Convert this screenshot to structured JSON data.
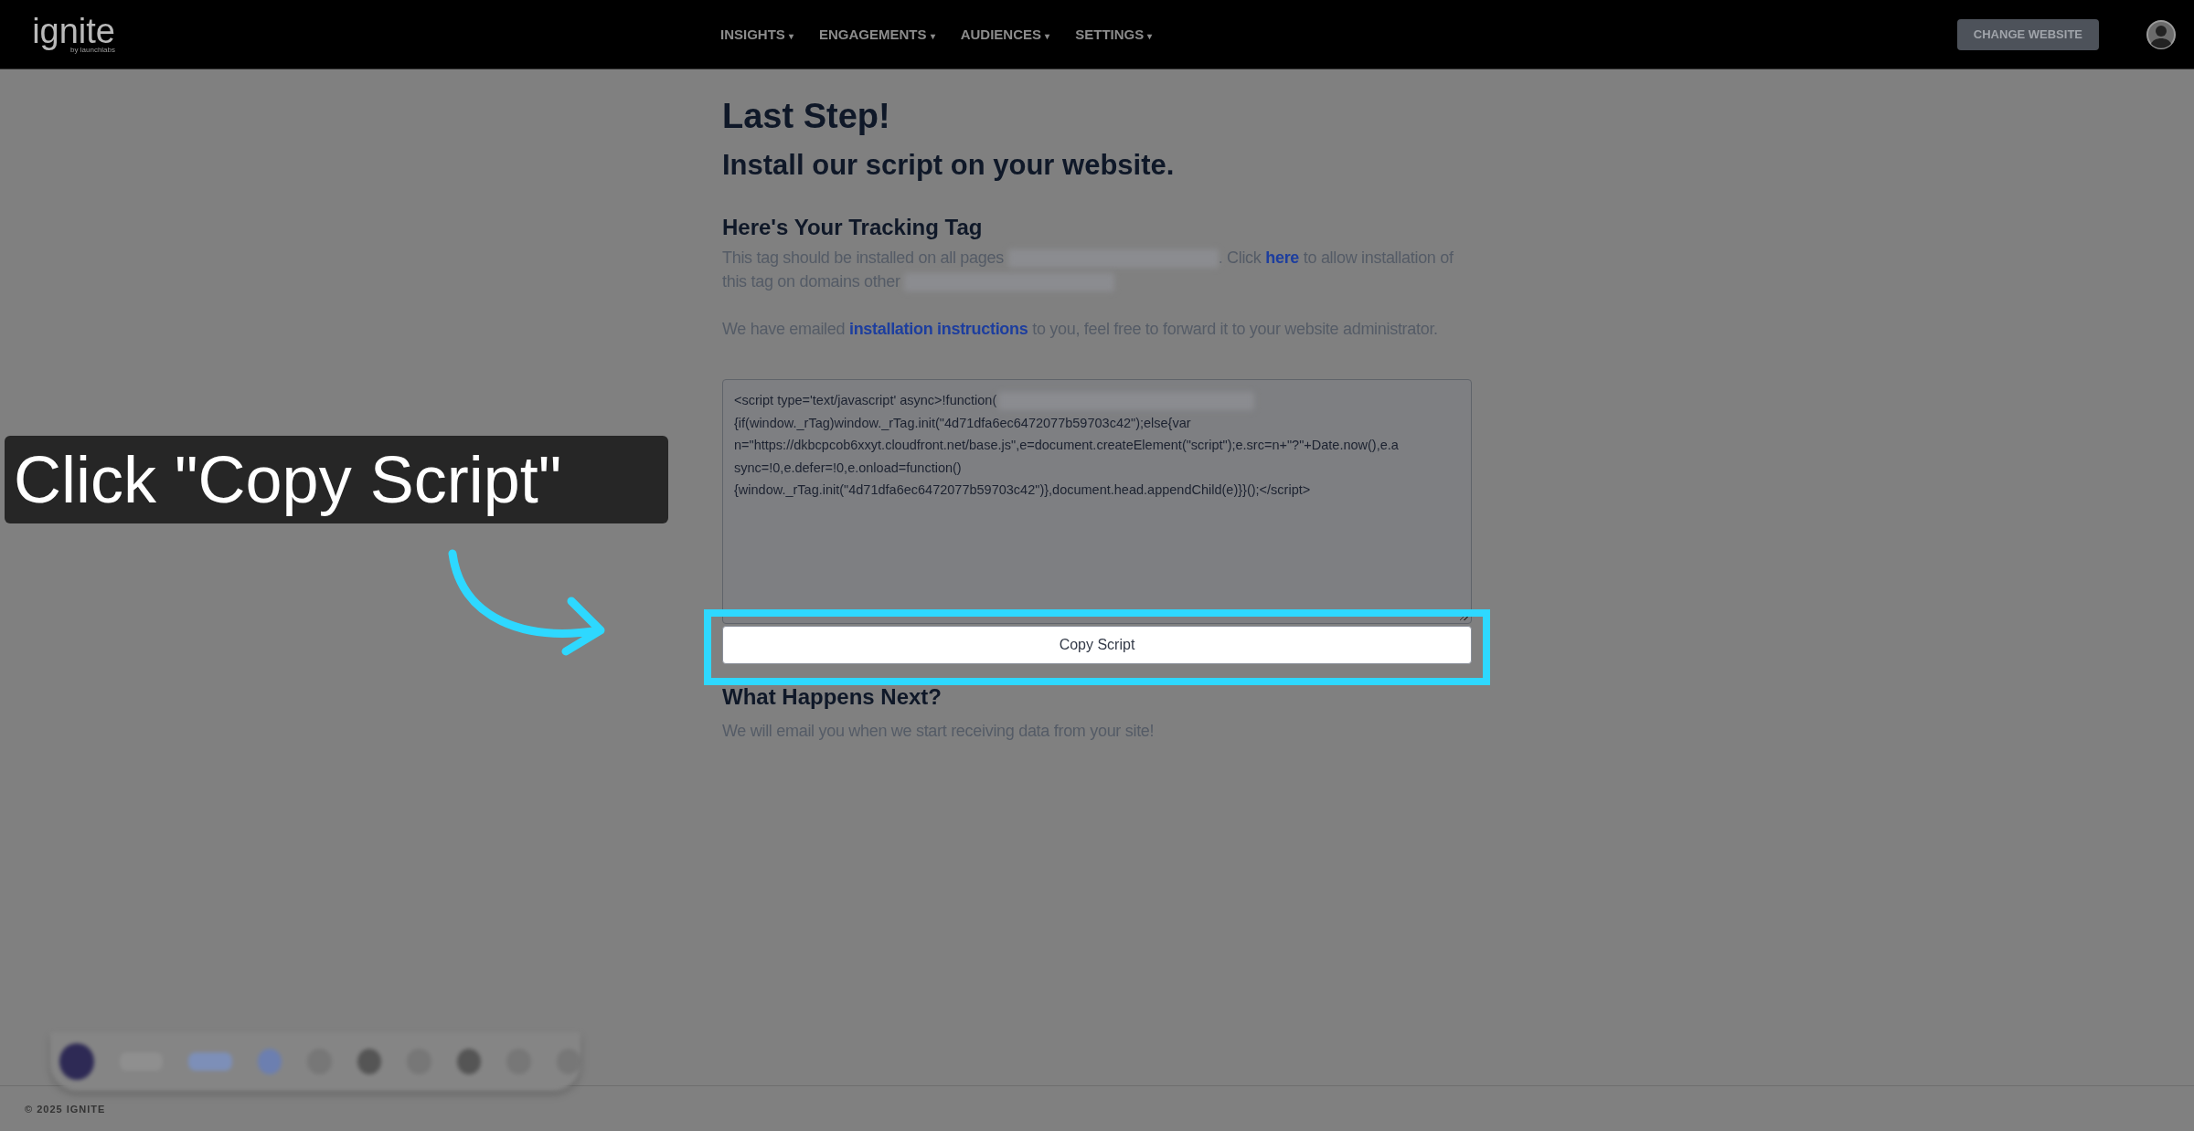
{
  "header": {
    "logo": "ignite",
    "logo_sub": "by launchlabs",
    "nav": [
      {
        "label": "INSIGHTS",
        "caret": "▾"
      },
      {
        "label": "ENGAGEMENTS",
        "caret": "▾"
      },
      {
        "label": "AUDIENCES",
        "caret": "▾"
      },
      {
        "label": "SETTINGS",
        "caret": "▾"
      }
    ],
    "change_website": "CHANGE WEBSITE"
  },
  "content": {
    "title": "Last Step!",
    "subtitle": "Install our script on your website.",
    "section_title": "Here's Your Tracking Tag",
    "paragraphs": [
      [
        {
          "kind": "text",
          "text": "This tag should be installed on all pages "
        },
        {
          "kind": "redacted"
        },
        {
          "kind": "text",
          "text": ". Click "
        },
        {
          "kind": "link",
          "text": "here"
        },
        {
          "kind": "text",
          "text": " to allow installation of this tag on domains other "
        },
        {
          "kind": "redacted"
        }
      ],
      [
        {
          "kind": "text",
          "text": "We have emailed "
        },
        {
          "kind": "link",
          "text": "installation instructions"
        },
        {
          "kind": "text",
          "text": " to you, feel free to forward it to your website administrator."
        }
      ]
    ],
    "script_lines": [
      "<script type='text/javascript' async>!function(",
      "{if(window._rTag)window._rTag.init(\"4d71dfa6ec6472077b59703c42\");else{var",
      "n=\"https://dkbcpcob6xxyt.cloudfront.net/base.js\",e=document.createElement(\"script\");e.src=n+\"?\"+Date.now(),e.a",
      "sync=!0,e.defer=!0,e.onload=function()",
      "{window._rTag.init(\"4d71dfa6ec6472077b59703c42\")},document.head.appendChild(e)}}();</script>"
    ],
    "copy_button": "Copy Script",
    "next_title": "What Happens Next?",
    "next_text": "We will email you when we start receiving data from your site!"
  },
  "footer": {
    "copyright": "© 2025 IGNITE"
  },
  "callout": {
    "text": "Click \"Copy Script\""
  }
}
